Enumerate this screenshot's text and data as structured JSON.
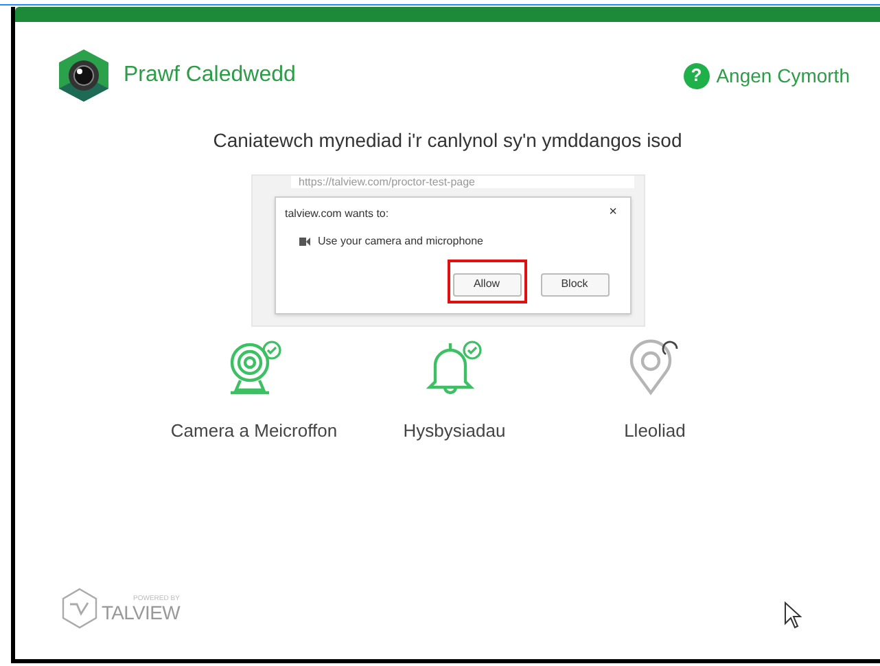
{
  "header": {
    "title": "Prawf Caledwedd",
    "help_icon": "?",
    "help": "Angen Cymorth"
  },
  "instruction": "Caniatewch mynediad i'r canlynol sy'n ymddangos isod",
  "example": {
    "url": "https://talview.com/proctor-test-page",
    "prompt": "talview.com wants to:",
    "close": "×",
    "request": "Use your camera and microphone",
    "buttons": [
      {
        "label": "Allow",
        "highlighted": true
      },
      {
        "label": "Block",
        "highlighted": false
      }
    ]
  },
  "permissions": [
    {
      "kind": "camera",
      "label": "Camera a Meicroffon",
      "granted": true
    },
    {
      "kind": "bell",
      "label": "Hysbysiadau",
      "granted": true
    },
    {
      "kind": "location",
      "label": "Lleoliad",
      "granted": false
    }
  ],
  "footer": {
    "powered": "POWERED BY",
    "brand": "TALVIEW"
  }
}
